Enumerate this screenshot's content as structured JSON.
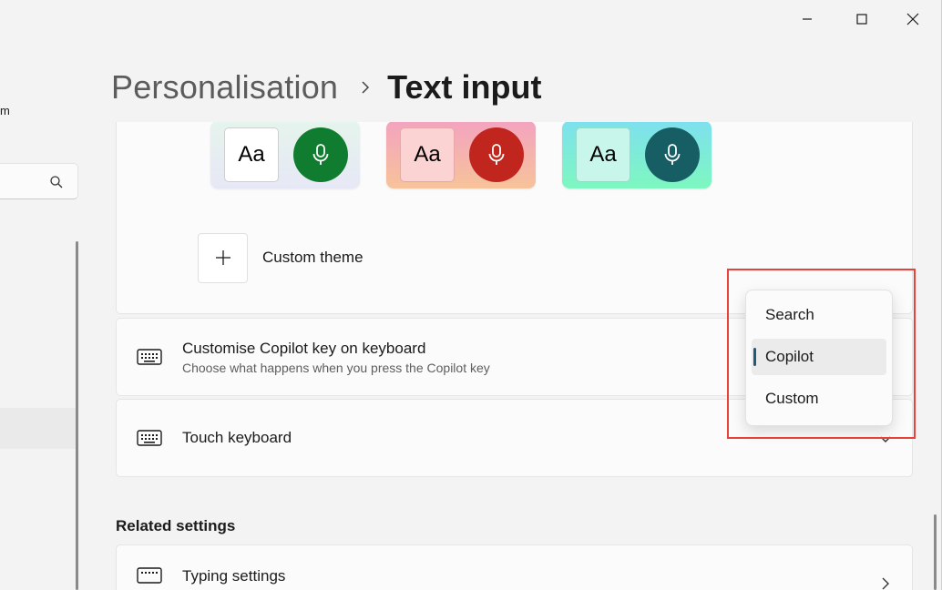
{
  "window": {
    "controls": {
      "minimize": "minimize",
      "maximize": "maximize",
      "close": "close"
    }
  },
  "nav": {
    "clipped_text": "m"
  },
  "header": {
    "breadcrumb_parent": "Personalisation",
    "breadcrumb_current": "Text input"
  },
  "themes": [
    {
      "label": "Aa",
      "mic_color": "#107c2f"
    },
    {
      "label": "Aa",
      "mic_color": "#c0261e"
    },
    {
      "label": "Aa",
      "mic_color": "#175e64"
    }
  ],
  "custom_theme": {
    "label": "Custom theme"
  },
  "copilot_key": {
    "title": "Customise Copilot key on keyboard",
    "subtitle": "Choose what happens when you press the Copilot key"
  },
  "touch_keyboard": {
    "title": "Touch keyboard"
  },
  "related_settings": {
    "heading": "Related settings",
    "typing_settings": "Typing settings"
  },
  "dropdown": {
    "options": [
      "Search",
      "Copilot",
      "Custom"
    ],
    "selected": "Copilot"
  },
  "colors": {
    "highlight": "#e8403b",
    "accent": "#1f5a7a"
  }
}
